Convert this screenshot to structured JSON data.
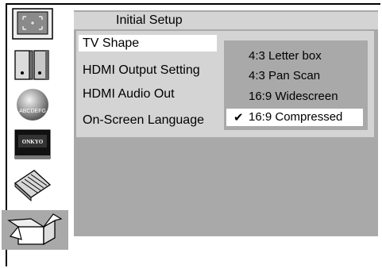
{
  "header": {
    "title": "Initial Setup"
  },
  "sidebar": {
    "icons": [
      {
        "name": "tv-screen-icon",
        "selected": false
      },
      {
        "name": "speakers-icon",
        "selected": false
      },
      {
        "name": "globe-language-icon",
        "globe_text": "ABCDEFG",
        "selected": false
      },
      {
        "name": "onkyo-player-icon",
        "brand_text": "ONKYO",
        "selected": false
      },
      {
        "name": "settings-panel-icon",
        "selected": false
      },
      {
        "name": "open-box-icon",
        "selected": true
      }
    ]
  },
  "menu": {
    "items": [
      {
        "label": "TV Shape",
        "selected": true
      },
      {
        "label": "HDMI Output Setting",
        "selected": false
      },
      {
        "label": "HDMI Audio Out",
        "selected": false
      },
      {
        "label": "On-Screen Language",
        "selected": false
      }
    ]
  },
  "submenu": {
    "check_mark": "✔",
    "options": [
      {
        "label": "4:3 Letter box",
        "selected": false
      },
      {
        "label": "4:3 Pan Scan",
        "selected": false
      },
      {
        "label": "16:9 Widescreen",
        "selected": false
      },
      {
        "label": "16:9 Compressed",
        "selected": true
      }
    ]
  },
  "colors": {
    "panel_gray": "#a9a9a9",
    "light_gray": "#d4d4d4",
    "highlight": "#ffffff"
  }
}
